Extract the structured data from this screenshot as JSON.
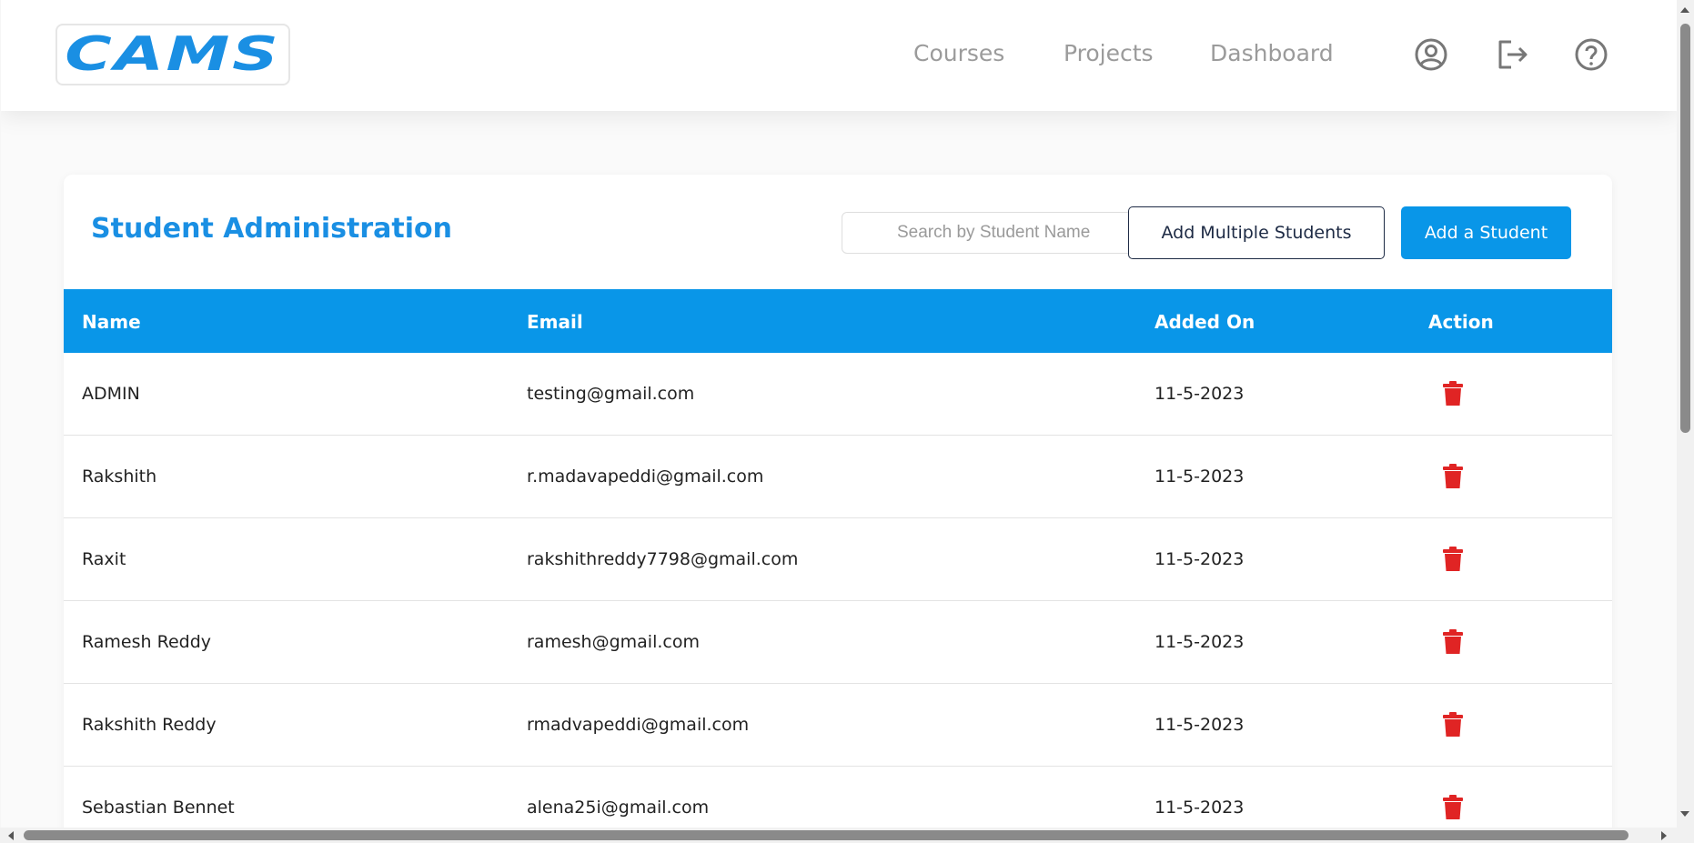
{
  "header": {
    "logo_text": "CAMS",
    "nav": [
      "Courses",
      "Projects",
      "Dashboard"
    ],
    "icons": [
      "user-circle-icon",
      "logout-icon",
      "help-icon"
    ]
  },
  "page": {
    "title": "Student Administration",
    "search_placeholder": "Search by Student Name",
    "add_multiple_label": "Add Multiple Students",
    "add_one_label": "Add a Student"
  },
  "table": {
    "columns": [
      "Name",
      "Email",
      "Added On",
      "Action"
    ],
    "rows": [
      {
        "name": "ADMIN",
        "email": "testing@gmail.com",
        "added_on": "11-5-2023"
      },
      {
        "name": "Rakshith",
        "email": "r.madavapeddi@gmail.com",
        "added_on": "11-5-2023"
      },
      {
        "name": "Raxit",
        "email": "rakshithreddy7798@gmail.com",
        "added_on": "11-5-2023"
      },
      {
        "name": "Ramesh Reddy",
        "email": "ramesh@gmail.com",
        "added_on": "11-5-2023"
      },
      {
        "name": "Rakshith Reddy",
        "email": "rmadvapeddi@gmail.com",
        "added_on": "11-5-2023"
      },
      {
        "name": "Sebastian Bennet",
        "email": "alena25i@gmail.com",
        "added_on": "11-5-2023"
      }
    ]
  },
  "colors": {
    "primary": "#0996e8",
    "delete": "#e02424",
    "nav_text": "#9b9b9b"
  }
}
